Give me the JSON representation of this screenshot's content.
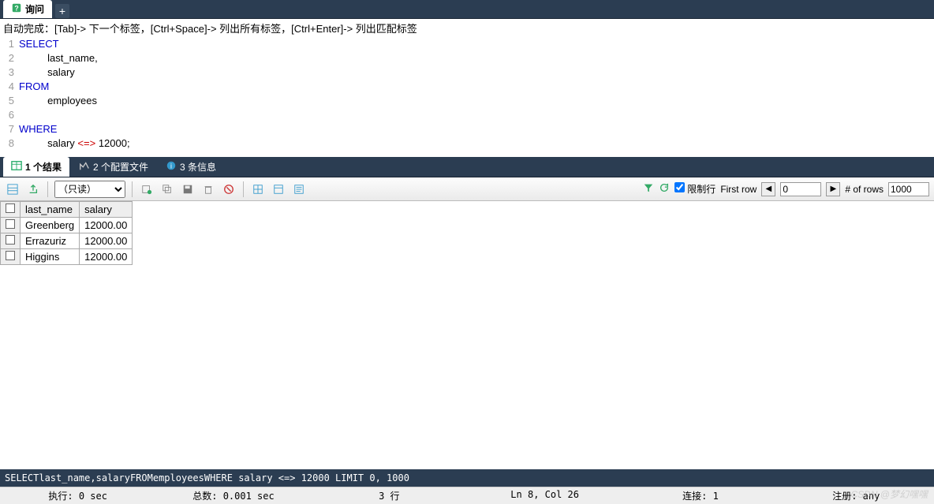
{
  "tabs": {
    "query": "询问",
    "add": "+"
  },
  "hint": "自动完成：[Tab]-> 下一个标签，[Ctrl+Space]-> 列出所有标签，[Ctrl+Enter]-> 列出匹配标签",
  "editor": {
    "lines": [
      "SELECT",
      "          last_name,",
      "          salary",
      "FROM",
      "          employees",
      "",
      "WHERE",
      "          salary <=> 12000;"
    ]
  },
  "result_tabs": {
    "results": "1 个结果",
    "profiles": "2 个配置文件",
    "messages": "3 条信息"
  },
  "toolbar": {
    "mode_readonly": "（只读）",
    "limit_label": "限制行",
    "first_row_label": "First row",
    "first_row_value": "0",
    "num_rows_label": "# of rows",
    "num_rows_value": "1000"
  },
  "columns": [
    "last_name",
    "salary"
  ],
  "rows": [
    {
      "last_name": "Greenberg",
      "salary": "12000.00"
    },
    {
      "last_name": "Errazuriz",
      "salary": "12000.00"
    },
    {
      "last_name": "Higgins",
      "salary": "12000.00"
    }
  ],
  "status_sql": "SELECTlast_name,salaryFROMemployeesWHERE salary <=> 12000 LIMIT 0, 1000",
  "status": {
    "exec": "执行: 0 sec",
    "total": "总数: 0.001 sec",
    "rows": "3 行",
    "pos": "Ln 8, Col 26",
    "conn": "连接: 1",
    "note": "注册: any"
  },
  "watermark": "CSDN @梦幻嘿嘿"
}
